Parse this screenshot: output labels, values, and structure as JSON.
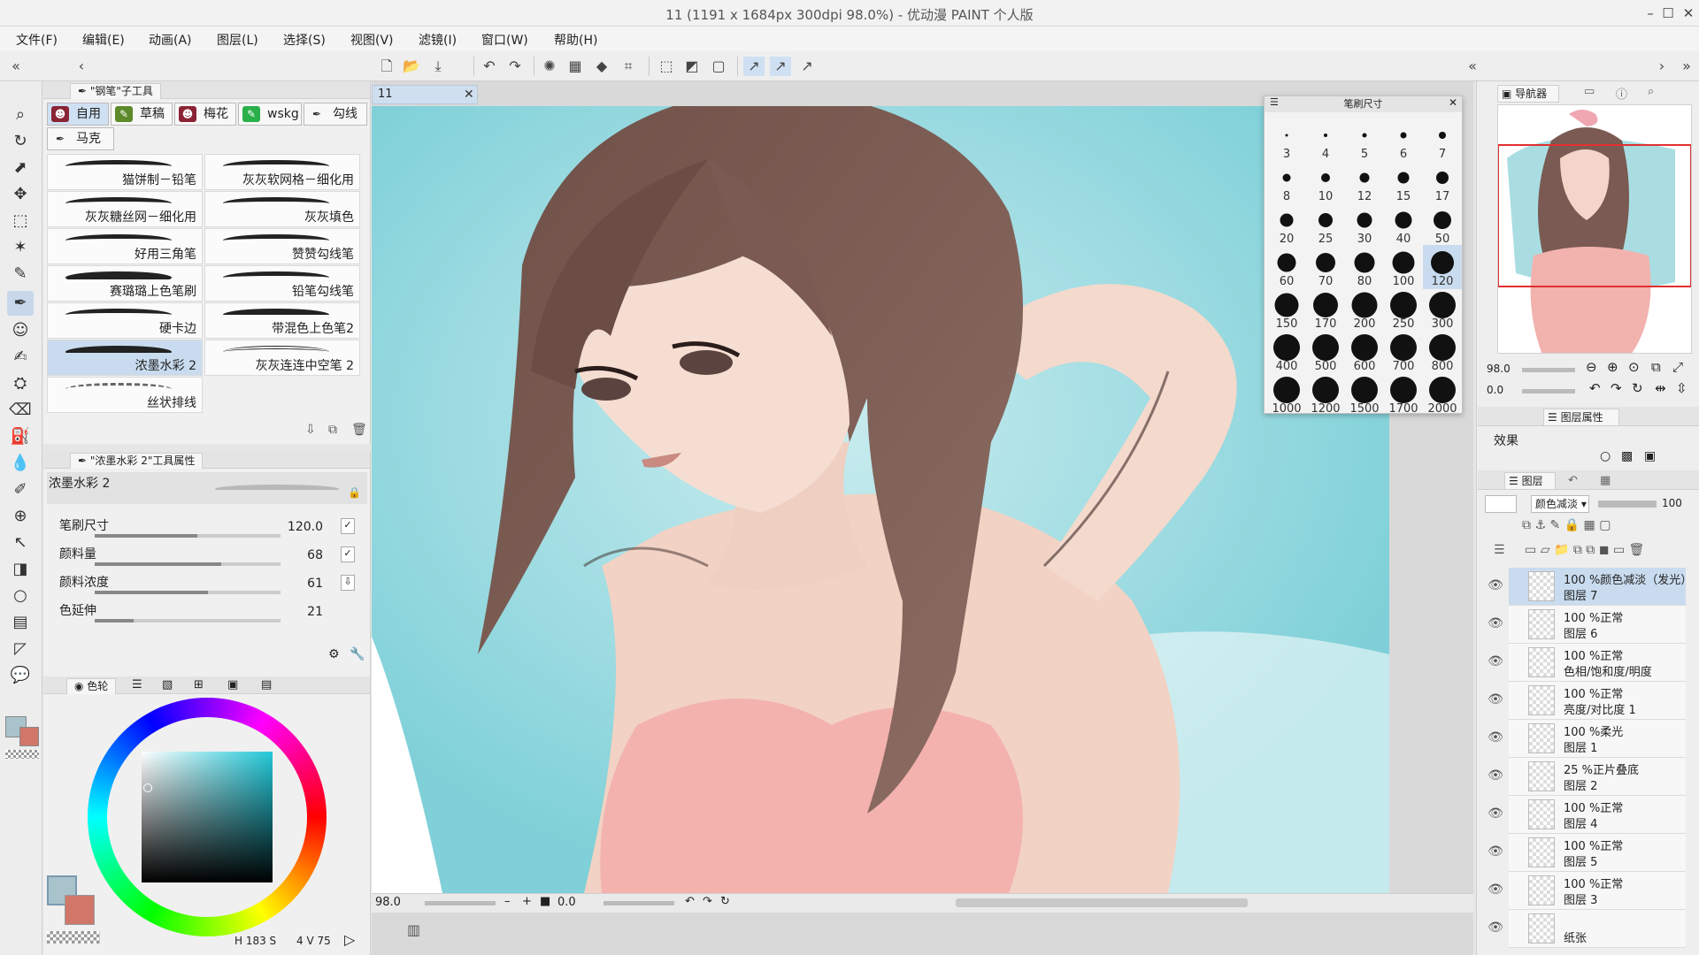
{
  "window": {
    "title": "11 (1191 x 1684px 300dpi 98.0%) - 优动漫 PAINT 个人版"
  },
  "menu": [
    "文件(F)",
    "编辑(E)",
    "动画(A)",
    "图层(L)",
    "选择(S)",
    "视图(V)",
    "滤镜(I)",
    "窗口(W)",
    "帮助(H)"
  ],
  "subtool": {
    "header": "\"钢笔\"子工具",
    "groups": [
      "自用",
      "草稿",
      "梅花",
      "wskg",
      "勾线",
      "马克"
    ],
    "brushes": [
      "猫饼制－铅笔",
      "灰灰软网格－细化用",
      "灰灰糖丝网－细化用",
      "灰灰填色",
      "好用三角笔",
      "赞赞勾线笔",
      "赛璐璐上色笔刷",
      "铅笔勾线笔",
      "硬卡边",
      "带混色上色笔2",
      "浓墨水彩 2",
      "灰灰连连中空笔 2",
      "丝状排线"
    ]
  },
  "toolprop": {
    "header": "\"浓墨水彩 2\"工具属性",
    "name": "浓墨水彩 2",
    "props": [
      {
        "label": "笔刷尺寸",
        "value": "120.0",
        "level": 0.55
      },
      {
        "label": "颜料量",
        "value": "68",
        "level": 0.68
      },
      {
        "label": "颜料浓度",
        "value": "61",
        "level": 0.61
      },
      {
        "label": "色延伸",
        "value": "21",
        "level": 0.21
      }
    ]
  },
  "color": {
    "tab": "色轮",
    "h": "H 183 S",
    "v": "4 V 75",
    "main_color": "#a9c3cc",
    "sub_color": "#d0776a"
  },
  "document": {
    "tab": "11",
    "zoom": "98.0",
    "rotation": "0.0"
  },
  "brushsize": {
    "title": "笔刷尺寸",
    "sizes": [
      "3",
      "4",
      "5",
      "6",
      "7",
      "8",
      "10",
      "12",
      "15",
      "17",
      "20",
      "25",
      "30",
      "40",
      "50",
      "60",
      "70",
      "80",
      "100",
      "120",
      "150",
      "170",
      "200",
      "250",
      "300",
      "400",
      "500",
      "600",
      "700",
      "800",
      "1000",
      "1200",
      "1500",
      "1700",
      "2000"
    ],
    "selected": "120"
  },
  "navigator": {
    "tab": "导航器",
    "zoom": "98.0",
    "rotation": "0.0"
  },
  "layerprop": {
    "tab": "图层属性",
    "effect": "效果"
  },
  "layers": {
    "tab": "图层",
    "blend": "颜色减淡",
    "opacity": "100",
    "items": [
      {
        "l1": "100 %颜色减淡（发光）",
        "l2": "图层 7"
      },
      {
        "l1": "100 %正常",
        "l2": "图层 6"
      },
      {
        "l1": "100 %正常",
        "l2": "色相/饱和度/明度"
      },
      {
        "l1": "100 %正常",
        "l2": "亮度/对比度 1"
      },
      {
        "l1": "100 %柔光",
        "l2": "图层 1"
      },
      {
        "l1": "25 %正片叠底",
        "l2": "图层 2"
      },
      {
        "l1": "100 %正常",
        "l2": "图层 4"
      },
      {
        "l1": "100 %正常",
        "l2": "图层 5"
      },
      {
        "l1": "100 %正常",
        "l2": "图层 3"
      },
      {
        "l1": "",
        "l2": "纸张"
      }
    ]
  }
}
